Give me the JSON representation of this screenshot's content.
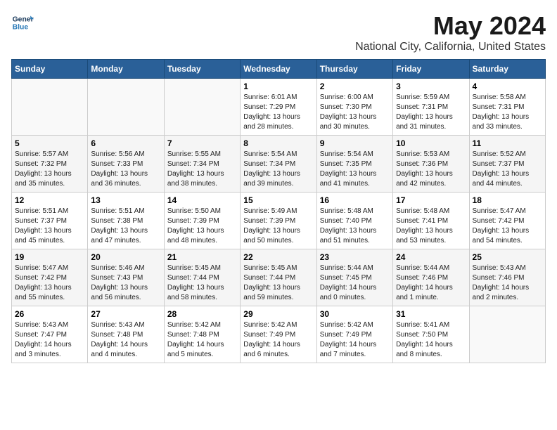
{
  "logo": {
    "line1": "General",
    "line2": "Blue"
  },
  "title": "May 2024",
  "subtitle": "National City, California, United States",
  "weekdays": [
    "Sunday",
    "Monday",
    "Tuesday",
    "Wednesday",
    "Thursday",
    "Friday",
    "Saturday"
  ],
  "weeks": [
    [
      {
        "day": "",
        "info": ""
      },
      {
        "day": "",
        "info": ""
      },
      {
        "day": "",
        "info": ""
      },
      {
        "day": "1",
        "info": "Sunrise: 6:01 AM\nSunset: 7:29 PM\nDaylight: 13 hours\nand 28 minutes."
      },
      {
        "day": "2",
        "info": "Sunrise: 6:00 AM\nSunset: 7:30 PM\nDaylight: 13 hours\nand 30 minutes."
      },
      {
        "day": "3",
        "info": "Sunrise: 5:59 AM\nSunset: 7:31 PM\nDaylight: 13 hours\nand 31 minutes."
      },
      {
        "day": "4",
        "info": "Sunrise: 5:58 AM\nSunset: 7:31 PM\nDaylight: 13 hours\nand 33 minutes."
      }
    ],
    [
      {
        "day": "5",
        "info": "Sunrise: 5:57 AM\nSunset: 7:32 PM\nDaylight: 13 hours\nand 35 minutes."
      },
      {
        "day": "6",
        "info": "Sunrise: 5:56 AM\nSunset: 7:33 PM\nDaylight: 13 hours\nand 36 minutes."
      },
      {
        "day": "7",
        "info": "Sunrise: 5:55 AM\nSunset: 7:34 PM\nDaylight: 13 hours\nand 38 minutes."
      },
      {
        "day": "8",
        "info": "Sunrise: 5:54 AM\nSunset: 7:34 PM\nDaylight: 13 hours\nand 39 minutes."
      },
      {
        "day": "9",
        "info": "Sunrise: 5:54 AM\nSunset: 7:35 PM\nDaylight: 13 hours\nand 41 minutes."
      },
      {
        "day": "10",
        "info": "Sunrise: 5:53 AM\nSunset: 7:36 PM\nDaylight: 13 hours\nand 42 minutes."
      },
      {
        "day": "11",
        "info": "Sunrise: 5:52 AM\nSunset: 7:37 PM\nDaylight: 13 hours\nand 44 minutes."
      }
    ],
    [
      {
        "day": "12",
        "info": "Sunrise: 5:51 AM\nSunset: 7:37 PM\nDaylight: 13 hours\nand 45 minutes."
      },
      {
        "day": "13",
        "info": "Sunrise: 5:51 AM\nSunset: 7:38 PM\nDaylight: 13 hours\nand 47 minutes."
      },
      {
        "day": "14",
        "info": "Sunrise: 5:50 AM\nSunset: 7:39 PM\nDaylight: 13 hours\nand 48 minutes."
      },
      {
        "day": "15",
        "info": "Sunrise: 5:49 AM\nSunset: 7:39 PM\nDaylight: 13 hours\nand 50 minutes."
      },
      {
        "day": "16",
        "info": "Sunrise: 5:48 AM\nSunset: 7:40 PM\nDaylight: 13 hours\nand 51 minutes."
      },
      {
        "day": "17",
        "info": "Sunrise: 5:48 AM\nSunset: 7:41 PM\nDaylight: 13 hours\nand 53 minutes."
      },
      {
        "day": "18",
        "info": "Sunrise: 5:47 AM\nSunset: 7:42 PM\nDaylight: 13 hours\nand 54 minutes."
      }
    ],
    [
      {
        "day": "19",
        "info": "Sunrise: 5:47 AM\nSunset: 7:42 PM\nDaylight: 13 hours\nand 55 minutes."
      },
      {
        "day": "20",
        "info": "Sunrise: 5:46 AM\nSunset: 7:43 PM\nDaylight: 13 hours\nand 56 minutes."
      },
      {
        "day": "21",
        "info": "Sunrise: 5:45 AM\nSunset: 7:44 PM\nDaylight: 13 hours\nand 58 minutes."
      },
      {
        "day": "22",
        "info": "Sunrise: 5:45 AM\nSunset: 7:44 PM\nDaylight: 13 hours\nand 59 minutes."
      },
      {
        "day": "23",
        "info": "Sunrise: 5:44 AM\nSunset: 7:45 PM\nDaylight: 14 hours\nand 0 minutes."
      },
      {
        "day": "24",
        "info": "Sunrise: 5:44 AM\nSunset: 7:46 PM\nDaylight: 14 hours\nand 1 minute."
      },
      {
        "day": "25",
        "info": "Sunrise: 5:43 AM\nSunset: 7:46 PM\nDaylight: 14 hours\nand 2 minutes."
      }
    ],
    [
      {
        "day": "26",
        "info": "Sunrise: 5:43 AM\nSunset: 7:47 PM\nDaylight: 14 hours\nand 3 minutes."
      },
      {
        "day": "27",
        "info": "Sunrise: 5:43 AM\nSunset: 7:48 PM\nDaylight: 14 hours\nand 4 minutes."
      },
      {
        "day": "28",
        "info": "Sunrise: 5:42 AM\nSunset: 7:48 PM\nDaylight: 14 hours\nand 5 minutes."
      },
      {
        "day": "29",
        "info": "Sunrise: 5:42 AM\nSunset: 7:49 PM\nDaylight: 14 hours\nand 6 minutes."
      },
      {
        "day": "30",
        "info": "Sunrise: 5:42 AM\nSunset: 7:49 PM\nDaylight: 14 hours\nand 7 minutes."
      },
      {
        "day": "31",
        "info": "Sunrise: 5:41 AM\nSunset: 7:50 PM\nDaylight: 14 hours\nand 8 minutes."
      },
      {
        "day": "",
        "info": ""
      }
    ]
  ]
}
